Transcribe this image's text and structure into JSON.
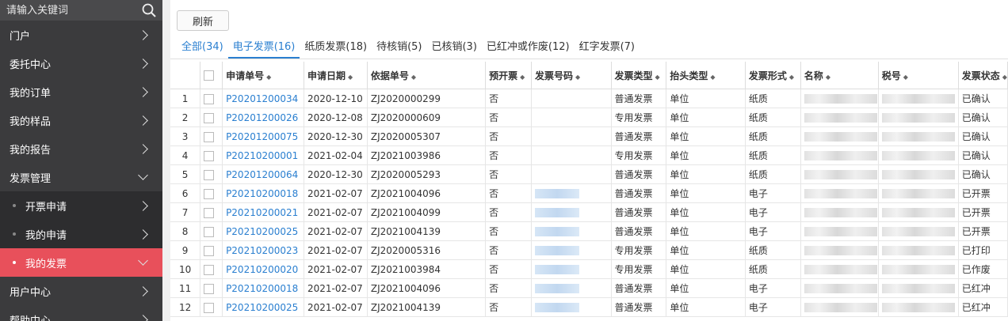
{
  "search": {
    "placeholder": "请输入关键词"
  },
  "sidebar": {
    "items": [
      {
        "label": "门户",
        "type": "top",
        "expanded": false
      },
      {
        "label": "委托中心",
        "type": "top",
        "expanded": false
      },
      {
        "label": "我的订单",
        "type": "top",
        "expanded": false
      },
      {
        "label": "我的样品",
        "type": "top",
        "expanded": false
      },
      {
        "label": "我的报告",
        "type": "top",
        "expanded": false
      },
      {
        "label": "发票管理",
        "type": "top",
        "expanded": true
      },
      {
        "label": "开票申请",
        "type": "sub",
        "active": false
      },
      {
        "label": "我的申请",
        "type": "sub",
        "active": false
      },
      {
        "label": "我的发票",
        "type": "sub",
        "active": true
      },
      {
        "label": "用户中心",
        "type": "top",
        "expanded": false
      },
      {
        "label": "帮助中心",
        "type": "top",
        "expanded": false
      }
    ]
  },
  "toolbar": {
    "refresh_label": "刷新"
  },
  "tabs": [
    {
      "label": "全部(34)"
    },
    {
      "label": "电子发票(16)"
    },
    {
      "label": "纸质发票(18)"
    },
    {
      "label": "待核销(5)"
    },
    {
      "label": "已核销(3)"
    },
    {
      "label": "已红冲或作废(12)"
    },
    {
      "label": "红字发票(7)"
    }
  ],
  "table": {
    "headers": [
      "申请单号",
      "申请日期",
      "依据单号",
      "预开票",
      "发票号码",
      "发票类型",
      "抬头类型",
      "发票形式",
      "名称",
      "税号",
      "发票状态"
    ],
    "rows": [
      {
        "no": "1",
        "apply_no": "P20201200034",
        "date": "2020-12-10",
        "basis": "ZJ2020000299",
        "pre": "否",
        "inv_no": "",
        "inv_type": "普通发票",
        "title_type": "单位",
        "form": "纸质",
        "status": "已确认"
      },
      {
        "no": "2",
        "apply_no": "P20201200026",
        "date": "2020-12-08",
        "basis": "ZJ2020000609",
        "pre": "否",
        "inv_no": "",
        "inv_type": "专用发票",
        "title_type": "单位",
        "form": "纸质",
        "status": "已确认"
      },
      {
        "no": "3",
        "apply_no": "P20201200075",
        "date": "2020-12-30",
        "basis": "ZJ2020005307",
        "pre": "否",
        "inv_no": "",
        "inv_type": "普通发票",
        "title_type": "单位",
        "form": "纸质",
        "status": "已确认"
      },
      {
        "no": "4",
        "apply_no": "P20210200001",
        "date": "2021-02-04",
        "basis": "ZJ2021003986",
        "pre": "否",
        "inv_no": "",
        "inv_type": "专用发票",
        "title_type": "单位",
        "form": "纸质",
        "status": "已确认"
      },
      {
        "no": "5",
        "apply_no": "P20201200064",
        "date": "2020-12-30",
        "basis": "ZJ2020005293",
        "pre": "否",
        "inv_no": "",
        "inv_type": "普通发票",
        "title_type": "单位",
        "form": "纸质",
        "status": "已确认"
      },
      {
        "no": "6",
        "apply_no": "P20210200018",
        "date": "2021-02-07",
        "basis": "ZJ2021004096",
        "pre": "否",
        "inv_no": "blurred",
        "inv_type": "普通发票",
        "title_type": "单位",
        "form": "电子",
        "status": "已开票"
      },
      {
        "no": "7",
        "apply_no": "P20210200021",
        "date": "2021-02-07",
        "basis": "ZJ2021004099",
        "pre": "否",
        "inv_no": "blurred",
        "inv_type": "普通发票",
        "title_type": "单位",
        "form": "电子",
        "status": "已开票"
      },
      {
        "no": "8",
        "apply_no": "P20210200025",
        "date": "2021-02-07",
        "basis": "ZJ2021004139",
        "pre": "否",
        "inv_no": "blurred",
        "inv_type": "普通发票",
        "title_type": "单位",
        "form": "电子",
        "status": "已开票"
      },
      {
        "no": "9",
        "apply_no": "P20210200023",
        "date": "2021-02-07",
        "basis": "ZJ2020005316",
        "pre": "否",
        "inv_no": "blurred",
        "inv_type": "专用发票",
        "title_type": "单位",
        "form": "纸质",
        "status": "已打印"
      },
      {
        "no": "10",
        "apply_no": "P20210200020",
        "date": "2021-02-07",
        "basis": "ZJ2021003984",
        "pre": "否",
        "inv_no": "blurred",
        "inv_type": "专用发票",
        "title_type": "单位",
        "form": "纸质",
        "status": "已作废"
      },
      {
        "no": "11",
        "apply_no": "P20210200018",
        "date": "2021-02-07",
        "basis": "ZJ2021004096",
        "pre": "否",
        "inv_no": "blurred",
        "inv_type": "普通发票",
        "title_type": "单位",
        "form": "电子",
        "status": "已红冲"
      },
      {
        "no": "12",
        "apply_no": "P20210200025",
        "date": "2021-02-07",
        "basis": "ZJ2021004139",
        "pre": "否",
        "inv_no": "blurred",
        "inv_type": "普通发票",
        "title_type": "单位",
        "form": "电子",
        "status": "已红冲"
      }
    ]
  },
  "colors": {
    "accent": "#2a7fd0",
    "sidebar_bg": "#3b3b3d",
    "active_item": "#e8505b"
  }
}
